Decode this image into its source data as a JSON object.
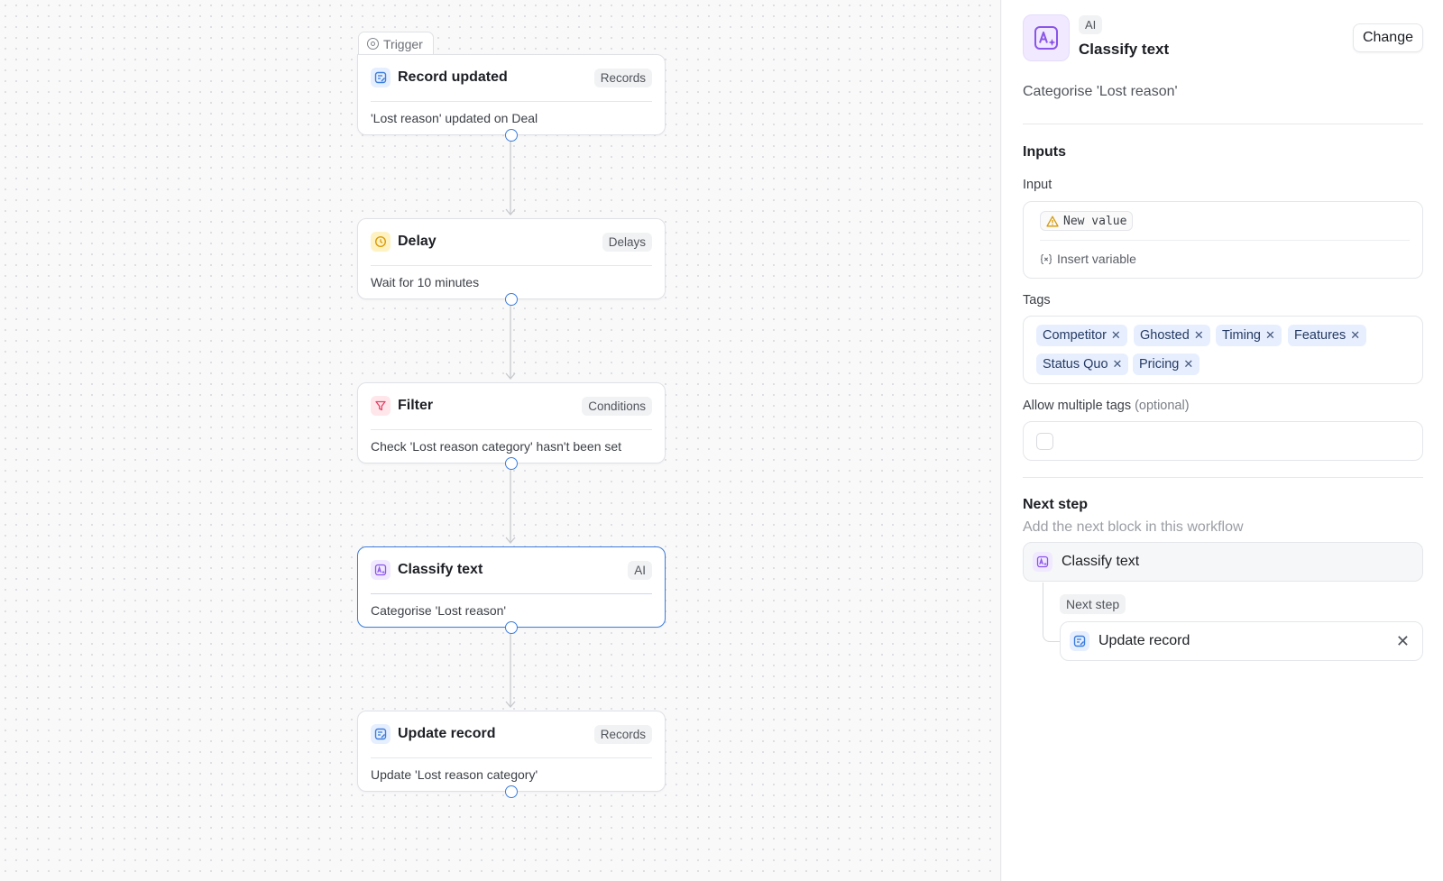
{
  "canvas": {
    "trigger_label": "Trigger",
    "nodes": [
      {
        "title": "Record updated",
        "badge": "Records",
        "description": "'Lost reason' updated on Deal",
        "icon": "record-icon"
      },
      {
        "title": "Delay",
        "badge": "Delays",
        "description": "Wait for 10 minutes",
        "icon": "clock-icon"
      },
      {
        "title": "Filter",
        "badge": "Conditions",
        "description": "Check 'Lost reason category' hasn't been set",
        "icon": "filter-icon"
      },
      {
        "title": "Classify text",
        "badge": "AI",
        "description": "Categorise 'Lost reason'",
        "icon": "ai-classify-icon",
        "selected": true
      },
      {
        "title": "Update record",
        "badge": "Records",
        "description": "Update 'Lost reason category'",
        "icon": "record-icon"
      }
    ]
  },
  "panel": {
    "category": "AI",
    "title": "Classify text",
    "change_label": "Change",
    "description": "Categorise 'Lost reason'",
    "inputs_heading": "Inputs",
    "input_label": "Input",
    "input_variable": "New value",
    "insert_variable": "Insert variable",
    "tags_label": "Tags",
    "tags": [
      "Competitor",
      "Ghosted",
      "Timing",
      "Features",
      "Status Quo",
      "Pricing"
    ],
    "multiple_label": "Allow multiple tags",
    "optional": "(optional)",
    "next_step_heading": "Next step",
    "next_step_sub": "Add the next block in this workflow",
    "current_step": "Classify text",
    "next_step_chip": "Next step",
    "next_step_name": "Update record"
  },
  "colors": {
    "accent": "#3c7ddb",
    "tag_bg": "#e7efff",
    "ai_bg": "#f1e9ff",
    "records_bg": "#e6efff",
    "delay_bg": "#fff2c2",
    "filter_bg": "#ffe6ea"
  }
}
